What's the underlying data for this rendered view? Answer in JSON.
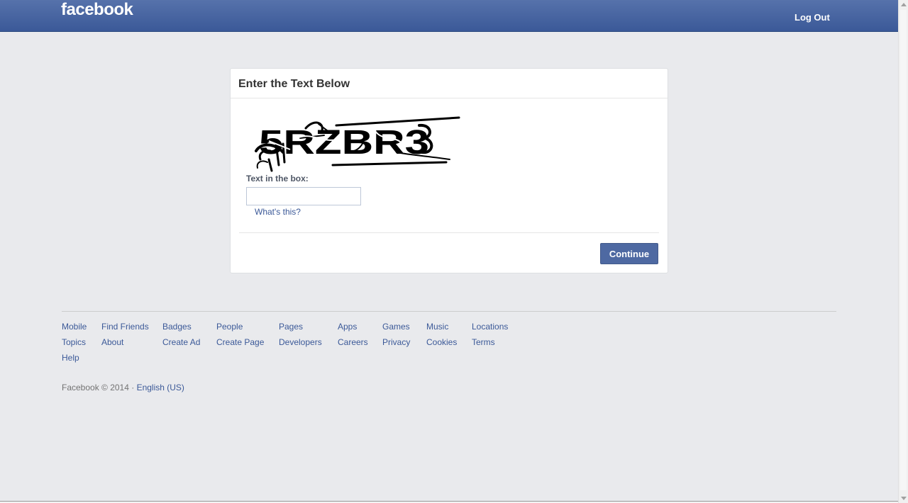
{
  "header": {
    "logo": "facebook",
    "logout_label": "Log Out"
  },
  "card": {
    "title": "Enter the Text Below",
    "captcha_text": "5RZBR3",
    "input_label": "Text in the box:",
    "input_value": "",
    "help_link": "What's this?",
    "continue_label": "Continue"
  },
  "footer": {
    "row1": [
      "Mobile",
      "Find Friends",
      "Badges",
      "People",
      "Pages",
      "Apps",
      "Games",
      "Music",
      "Locations"
    ],
    "row2": [
      "Topics",
      "About",
      "Create Ad",
      "Create Page",
      "Developers",
      "Careers",
      "Privacy",
      "Cookies",
      "Terms"
    ],
    "row3": [
      "Help"
    ],
    "copyright": "Facebook © 2014 · ",
    "language": "English (US)"
  },
  "colors": {
    "brand_blue": "#3b5998",
    "button_blue": "#4e69a2",
    "background": "#e9eaed"
  }
}
